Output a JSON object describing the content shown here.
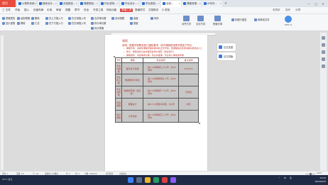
{
  "app": {
    "home_tab": "首页",
    "tabs": [
      {
        "label": "计算机系统..."
      },
      {
        "label": "程序设计..."
      },
      {
        "label": "实验报告..."
      },
      {
        "label": "课程规划..."
      },
      {
        "label": "作业说明..."
      },
      {
        "label": "毕业设计..."
      },
      {
        "label": "学业报告..."
      },
      {
        "label": "实验..."
      },
      {
        "label": "课程资源..."
      },
      {
        "label": "AI写作..."
      }
    ],
    "window_controls": [
      "—",
      "▢",
      "✕"
    ]
  },
  "menubar": {
    "items": [
      "三 文件",
      "开始",
      "插入",
      "页面布局",
      "引用",
      "审阅",
      "视图",
      "章节",
      "安全",
      "开发工具",
      "特色功能",
      "表格工具",
      "表格样式",
      "文档助手",
      "Q 查找"
    ],
    "active": "表格工具",
    "right": [
      "未同步",
      "协作",
      "分享"
    ]
  },
  "ribbon": {
    "groups": [
      {
        "label": "表格属性"
      },
      {
        "label": "显示虚框"
      },
      {
        "label": "绘制表格"
      },
      {
        "label": "擦除"
      },
      {
        "label": "删除"
      },
      {
        "label": "汇总"
      },
      {
        "label": "在上方插入行"
      },
      {
        "label": "在下方插入行"
      },
      {
        "label": "在左侧插入列"
      },
      {
        "label": "在右侧插入列"
      },
      {
        "label": "合并单元格"
      },
      {
        "label": "拆分单元格"
      },
      {
        "label": "拆分表格"
      },
      {
        "label": "自动调整"
      },
      {
        "label": "高度"
      },
      {
        "label": "宽度"
      },
      {
        "label": "宋体"
      },
      {
        "label": "对齐方式"
      },
      {
        "label": "文字方向"
      },
      {
        "label": "快速计算"
      },
      {
        "label": "标题行重复"
      },
      {
        "label": "转换成文本"
      }
    ],
    "ai_label": "WPS AI"
  },
  "document": {
    "title": "课程",
    "intro": "说明：根据学院教务部门通知要求，填写课程修读情况表如下所示：",
    "bullets": [
      "课程代码：请填写课程管理系统中的正式代码，若课程信息有误请联系教务办公室核实",
      "学分：按照培养方案中规定的学分填写（修读学分）",
      "课程类别：请选择通识课、专业基础课、专业核心课或选修课",
      "备注：如有补考、重修、免修等情况请在备注栏中注明"
    ],
    "table": {
      "headers": [
        "序号",
        "课程",
        "修读说明",
        "备注说明"
      ],
      "rows": [
        [
          "专业基础课",
          "程序设计基础",
          "第1-16周每周二3-4节，共32学时",
          "2024/11"
        ],
        [
          "专业核心课",
          "数据结构与算法",
          "第1-16周每周四1-2节，共32学时",
          ""
        ],
        [
          "专业选修课",
          "数据库原理（含实验）",
          "第3-18周每周一5-6节，共32学时",
          "已修完"
        ],
        [
          "实践课程",
          "课程设计",
          "第17-18周集中实践，共2周",
          "补修"
        ],
        [
          "通识课程",
          "大学英语",
          "第1-16周每周三7-8节，共32学时",
          ""
        ]
      ]
    }
  },
  "side_panel": {
    "cards": [
      {
        "label": "论文查重"
      },
      {
        "label": "论文排版"
      }
    ]
  },
  "statusbar": {
    "left": [
      "页码: 1",
      "页面: 1/1",
      "节: 1/1",
      "设置值: 6.6厘米",
      "行: 2",
      "列: 1",
      "字数: 146/472",
      "拼写检查",
      "文档校对"
    ],
    "zoom": "100%"
  },
  "taskbar": {
    "weather": "23°C 多云",
    "tray": [
      "^",
      "中",
      "英"
    ],
    "time": "13:42",
    "date": "2024/6/25"
  }
}
